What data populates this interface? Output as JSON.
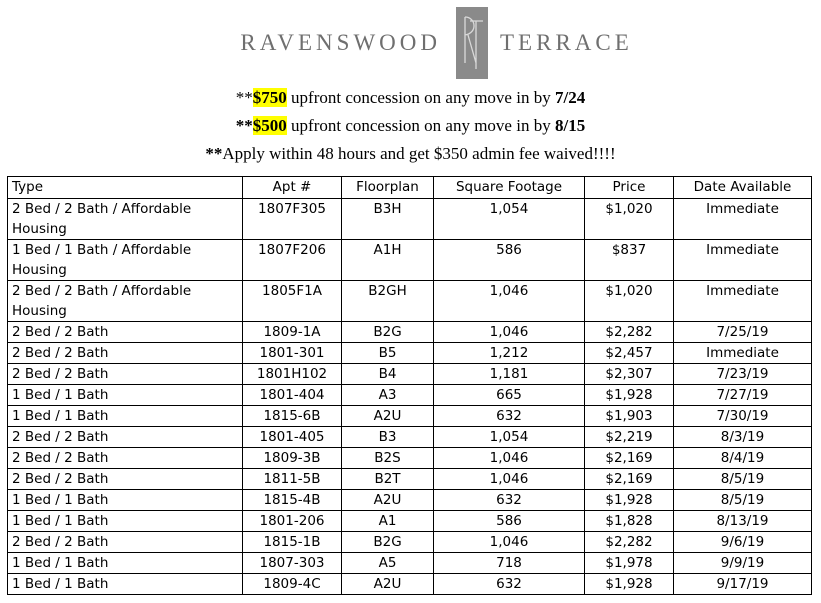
{
  "header": {
    "brand_left": "RAVENSWOOD",
    "brand_right": "TERRACE",
    "monogram": "RT"
  },
  "promos": [
    {
      "prefix": "**",
      "amount": "$750",
      "text": " upfront concession on any move in by ",
      "date": "7/24"
    },
    {
      "prefix": "**",
      "amount": "$500",
      "text": " upfront concession on any move in by ",
      "date": "8/15"
    },
    {
      "prefix": "**",
      "text": "Apply within 48 hours and get $350 admin fee waived!!!!"
    }
  ],
  "table": {
    "headers": [
      "Type",
      "Apt #",
      "Floorplan",
      "Square Footage",
      "Price",
      "Date Available"
    ],
    "rows": [
      [
        "2 Bed / 2 Bath / Affordable Housing",
        "1807F305",
        "B3H",
        "1,054",
        "$1,020",
        "Immediate"
      ],
      [
        "1 Bed / 1 Bath / Affordable Housing",
        "1807F206",
        "A1H",
        "586",
        "$837",
        "Immediate"
      ],
      [
        "2 Bed / 2 Bath / Affordable Housing",
        "1805F1A",
        "B2GH",
        "1,046",
        "$1,020",
        "Immediate"
      ],
      [
        "2 Bed / 2 Bath",
        "1809-1A",
        "B2G",
        "1,046",
        "$2,282",
        "7/25/19"
      ],
      [
        "2 Bed / 2 Bath",
        "1801-301",
        "B5",
        "1,212",
        "$2,457",
        "Immediate"
      ],
      [
        "2 Bed / 2 Bath",
        "1801H102",
        "B4",
        "1,181",
        "$2,307",
        "7/23/19"
      ],
      [
        "1 Bed / 1 Bath",
        "1801-404",
        "A3",
        "665",
        "$1,928",
        "7/27/19"
      ],
      [
        "1 Bed / 1 Bath",
        "1815-6B",
        "A2U",
        "632",
        "$1,903",
        "7/30/19"
      ],
      [
        "2 Bed / 2 Bath",
        "1801-405",
        "B3",
        "1,054",
        "$2,219",
        "8/3/19"
      ],
      [
        "2 Bed / 2 Bath",
        "1809-3B",
        "B2S",
        "1,046",
        "$2,169",
        "8/4/19"
      ],
      [
        "2 Bed / 2 Bath",
        "1811-5B",
        "B2T",
        "1,046",
        "$2,169",
        "8/5/19"
      ],
      [
        "1 Bed / 1 Bath",
        "1815-4B",
        "A2U",
        "632",
        "$1,928",
        "8/5/19"
      ],
      [
        "1 Bed / 1 Bath",
        "1801-206",
        "A1",
        "586",
        "$1,828",
        "8/13/19"
      ],
      [
        "2 Bed / 2 Bath",
        "1815-1B",
        "B2G",
        "1,046",
        "$2,282",
        "9/6/19"
      ],
      [
        "1 Bed / 1 Bath",
        "1807-303",
        "A5",
        "718",
        "$1,978",
        "9/9/19"
      ],
      [
        "1 Bed / 1 Bath",
        "1809-4C",
        "A2U",
        "632",
        "$1,928",
        "9/17/19"
      ]
    ]
  },
  "colors": {
    "highlight": "#ffff00",
    "brand_gray": "#6f6f6f",
    "monogram_bg": "#8a8a8a"
  }
}
